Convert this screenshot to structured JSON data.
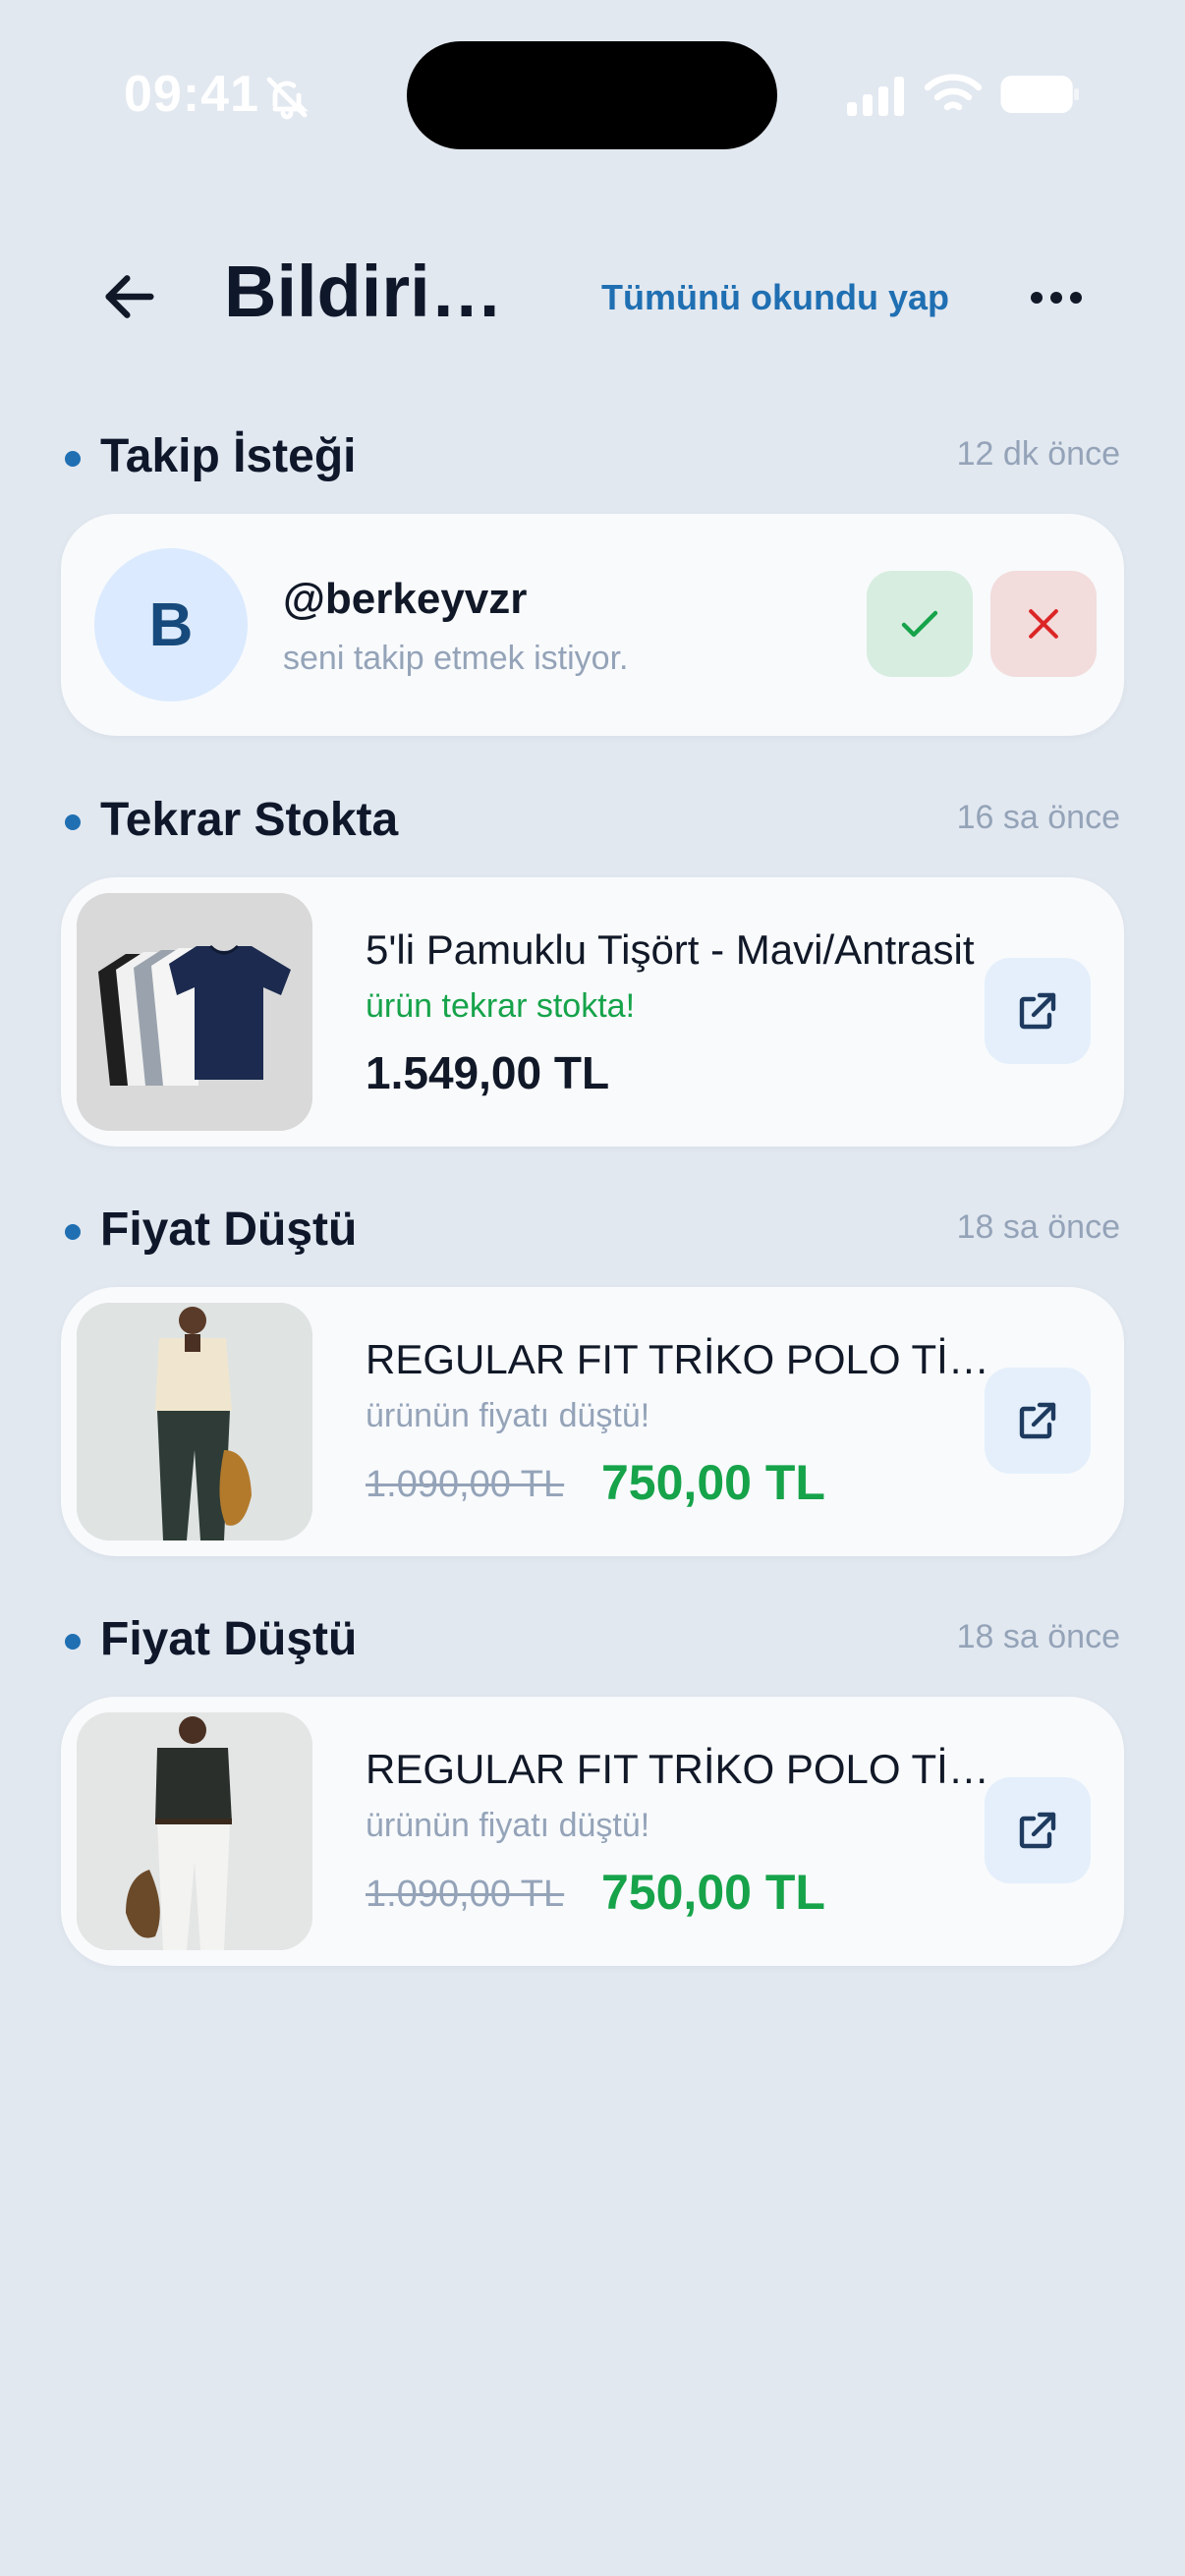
{
  "status_bar": {
    "time": "09:41",
    "icons": [
      "bell-slash-icon",
      "signal-icon",
      "wifi-icon",
      "battery-icon"
    ]
  },
  "header": {
    "title": "Bildirimler",
    "mark_all_read": "Tümünü okundu yap",
    "icons": [
      "arrow-left-icon",
      "more-horizontal-icon"
    ]
  },
  "colors": {
    "background": "#e2e8f0",
    "card": "#f8fafc",
    "accent": "#1f6fb2",
    "success": "#16a34a",
    "danger": "#dc2626",
    "muted": "#94a3b8"
  },
  "notifications": [
    {
      "type": "follow_request",
      "title": "Takip İsteği",
      "time": "12 dk önce",
      "avatar_letter": "B",
      "username": "@berkeyvzr",
      "message": "seni takip etmek istiyor.",
      "icons": [
        "check-icon",
        "x-icon"
      ]
    },
    {
      "type": "back_in_stock",
      "title": "Tekrar Stokta",
      "time": "16 sa önce",
      "product_name": "5'li Pamuklu Tişört - Mavi/Antrasit",
      "status": "ürün tekrar stokta!",
      "price": "1.549,00 TL",
      "icon": "external-link-icon"
    },
    {
      "type": "price_drop",
      "title": "Fiyat Düştü",
      "time": "18 sa önce",
      "product_name": "REGULAR FIT TRİKO POLO TİŞÖRT",
      "status": "ürünün fiyatı düştü!",
      "old_price": "1.090,00 TL",
      "new_price": "750,00 TL",
      "icon": "external-link-icon"
    },
    {
      "type": "price_drop",
      "title": "Fiyat Düştü",
      "time": "18 sa önce",
      "product_name": "REGULAR FIT TRİKO POLO TİŞÖRT",
      "status": "ürünün fiyatı düştü!",
      "old_price": "1.090,00 TL",
      "new_price": "750,00 TL",
      "icon": "external-link-icon"
    }
  ]
}
